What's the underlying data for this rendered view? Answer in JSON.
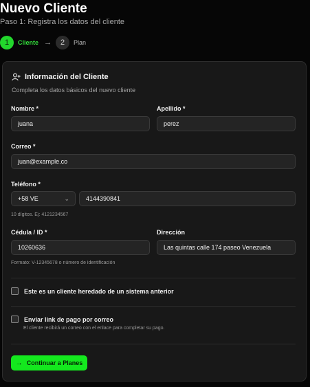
{
  "header": {
    "title": "Nuevo Cliente",
    "subtitle": "Paso 1: Registra los datos del cliente"
  },
  "stepper": {
    "steps": [
      {
        "number": "1",
        "label": "Cliente",
        "active": true
      },
      {
        "number": "2",
        "label": "Plan",
        "active": false
      }
    ]
  },
  "card": {
    "title": "Información del Cliente",
    "description": "Completa los datos básicos del nuevo cliente",
    "icon": "user-plus-icon"
  },
  "form": {
    "nombre": {
      "label": "Nombre *",
      "value": "juana"
    },
    "apellido": {
      "label": "Apellido *",
      "value": "perez"
    },
    "correo": {
      "label": "Correo *",
      "value": "juan@example.co"
    },
    "telefono": {
      "label": "Teléfono *",
      "country_code": "+58 VE",
      "value": "4144390841",
      "hint": "10 dígitos. Ej: 4121234567"
    },
    "cedula": {
      "label": "Cédula / ID *",
      "value": "10260636",
      "hint": "Formato: V-12345678 o número de identificación"
    },
    "direccion": {
      "label": "Dirección",
      "value": "Las quintas calle 174 paseo Venezuela"
    },
    "legacy_checkbox": {
      "label": "Este es un cliente heredado de un sistema anterior",
      "checked": false
    },
    "payment_link_checkbox": {
      "label": "Enviar link de pago por correo",
      "hint": "El cliente recibirá un correo con el enlace para completar su pago.",
      "checked": false
    }
  },
  "actions": {
    "continue_label": "Continuar a Planes"
  },
  "colors": {
    "accent": "#14e81e",
    "background": "#060606",
    "card": "#181818"
  }
}
